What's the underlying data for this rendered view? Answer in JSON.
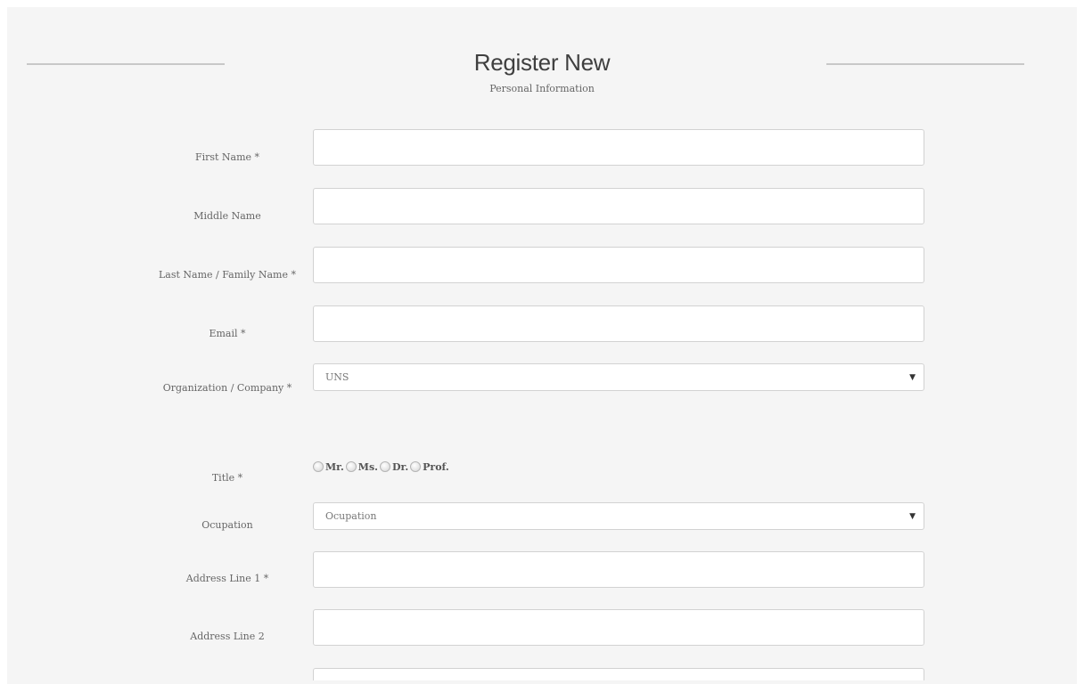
{
  "header": {
    "title": "Register New",
    "subtitle": "Personal Information"
  },
  "form": {
    "first_name": {
      "label": "First Name *",
      "value": ""
    },
    "middle_name": {
      "label": "Middle Name",
      "value": ""
    },
    "last_name": {
      "label": "Last Name / Family Name *",
      "value": ""
    },
    "email": {
      "label": "Email *",
      "value": ""
    },
    "organization": {
      "label": "Organization / Company *",
      "selected": "UNS"
    },
    "title": {
      "label": "Title *",
      "options": [
        "Mr.",
        "Ms.",
        "Dr.",
        "Prof."
      ]
    },
    "occupation": {
      "label": "Ocupation",
      "selected": "Ocupation"
    },
    "address_line_1": {
      "label": "Address Line 1 *",
      "value": ""
    },
    "address_line_2": {
      "label": "Address Line 2",
      "value": ""
    }
  },
  "icons": {
    "dropdown_caret": "▼"
  }
}
